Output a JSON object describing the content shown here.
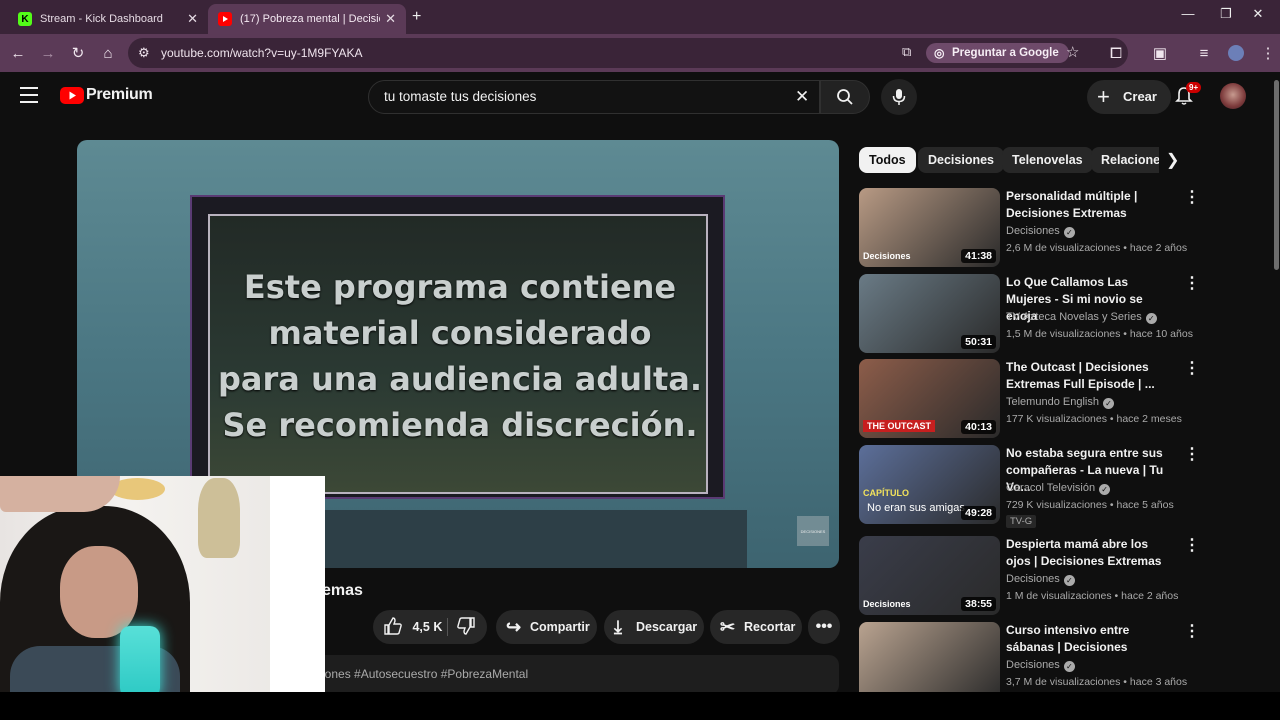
{
  "browser": {
    "tabs": [
      {
        "title": "Stream - Kick Dashboard",
        "favicon": "K"
      },
      {
        "title": "(17) Pobreza mental | Decisione",
        "favicon": "yt"
      }
    ],
    "url": "youtube.com/watch?v=uy-1M9FYAKA",
    "ask_google": "Preguntar a Google"
  },
  "youtube": {
    "logo_text": "Premium",
    "search_query": "tu tomaste tus decisiones",
    "create_label": "Crear",
    "notif_count": "9+"
  },
  "player": {
    "warning_lines": [
      "Este programa contiene",
      "material considerado",
      "para una audiencia adulta.",
      "Se recomienda discreción."
    ],
    "watermark": "DECISIONES"
  },
  "video": {
    "title_visible": "emas",
    "likes": "4,5 K",
    "share_label": "Compartir",
    "download_label": "Descargar",
    "clip_label": "Recortar",
    "hashtags": "iones #Autosecuestro #PobrezaMental"
  },
  "chips": [
    "Todos",
    "Decisiones",
    "Telenovelas",
    "Relacione"
  ],
  "recommendations": [
    {
      "title": "Personalidad múltiple | Decisiones Extremas",
      "channel": "Decisiones",
      "meta": "2,6 M de visualizaciones • hace 2 años",
      "duration": "41:38",
      "thumb_color": "#b89a84",
      "overlay": "Decisiones"
    },
    {
      "title": "Lo Que Callamos Las Mujeres - Si mi novio se enoja",
      "channel": "TV Azteca Novelas y Series",
      "meta": "1,5 M de visualizaciones • hace 10 años",
      "duration": "50:31",
      "thumb_color": "#6a7b86",
      "overlay": ""
    },
    {
      "title": "The Outcast | Decisiones Extremas Full Episode | ...",
      "channel": "Telemundo English",
      "meta": "177 K visualizaciones • hace 2 meses",
      "duration": "40:13",
      "thumb_color": "#8d5d4a",
      "overlay": "THE OUTCAST"
    },
    {
      "title": "No estaba segura entre sus compañeras - La nueva | Tu Vo...",
      "channel": "Caracol Televisión",
      "meta": "729 K visualizaciones • hace 5 años",
      "duration": "49:28",
      "thumb_color": "#5c6f9a",
      "overlay": "CAPÍTULO",
      "overlay2": "No eran sus amigas",
      "badge": "TV-G"
    },
    {
      "title": "Despierta mamá abre los ojos | Decisiones Extremas",
      "channel": "Decisiones",
      "meta": "1 M de visualizaciones • hace 2 años",
      "duration": "38:55",
      "thumb_color": "#3a3d4a",
      "overlay": "Decisiones"
    },
    {
      "title": "Curso intensivo entre sábanas | Decisiones",
      "channel": "Decisiones",
      "meta": "3,7 M de visualizaciones • hace 3 años",
      "duration": "",
      "thumb_color": "#b9a390",
      "overlay": ""
    }
  ]
}
